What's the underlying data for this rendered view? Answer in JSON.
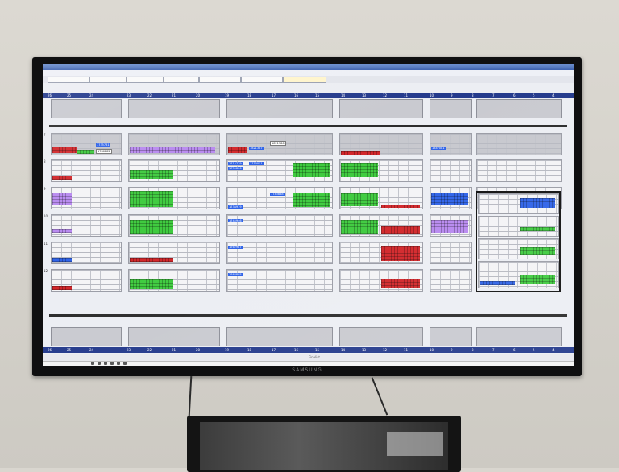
{
  "tv": {
    "brand": "SAMSUNG"
  },
  "app": {
    "title": "",
    "menu": [
      "",
      "",
      ""
    ],
    "toolbar_tabs": [
      "",
      "",
      "",
      "",
      "",
      "",
      ""
    ],
    "status_text": "Finalist"
  },
  "columns": {
    "top": [
      "26",
      "25",
      "24",
      "23",
      "22",
      "21",
      "20",
      "19",
      "18",
      "17",
      "16",
      "15",
      "14",
      "13",
      "12",
      "11",
      "10",
      "9",
      "8",
      "7",
      "6",
      "5",
      "4",
      "3",
      "2",
      "1"
    ],
    "bottom": [
      "26",
      "25",
      "24",
      "23",
      "22",
      "21",
      "20",
      "19",
      "18",
      "17",
      "16",
      "15",
      "14",
      "13",
      "12",
      "11",
      "10",
      "9",
      "8",
      "7",
      "6",
      "5",
      "4",
      "3",
      "2",
      "1"
    ]
  },
  "rows": [
    "7",
    "8",
    "9",
    "10",
    "11",
    "12",
    "13",
    "14"
  ],
  "labels": {
    "b1": "1735781",
    "b2": "1786282",
    "b3": "1821387",
    "b4": "1821386",
    "b5": "1847081",
    "b6": "1715779",
    "b7": "1710051",
    "b8": "1755806",
    "b9": "1734979",
    "b10": "1743888",
    "b11": "1745946",
    "b12": "1762987",
    "b13": "1764895"
  },
  "colors": {
    "green": "#3fcb3f",
    "red": "#d2262a",
    "blue": "#2f63e8",
    "violet": "#b889f0",
    "header": "#243a8c"
  }
}
